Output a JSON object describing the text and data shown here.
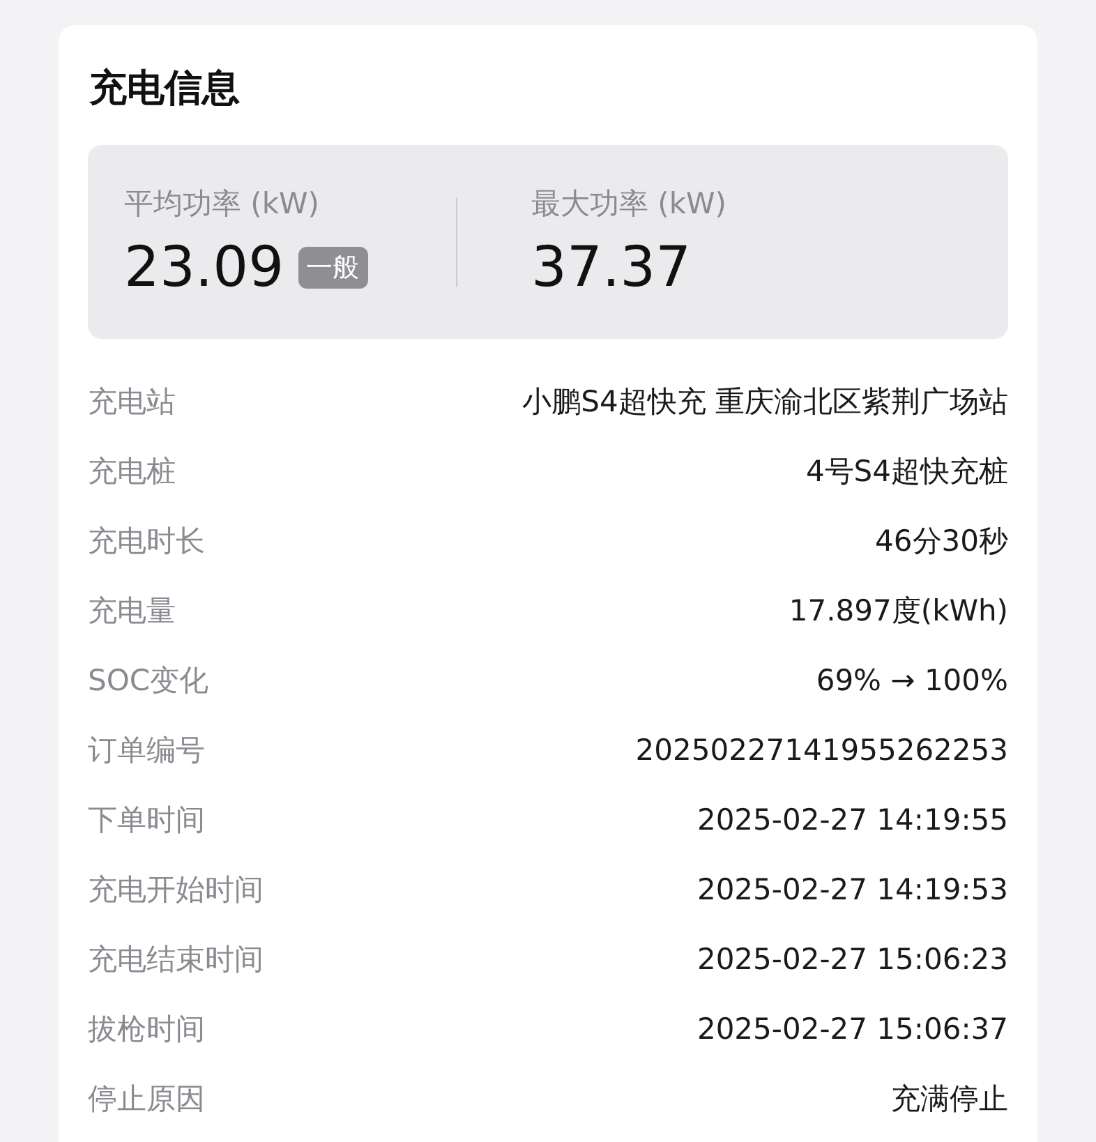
{
  "card": {
    "title": "充电信息",
    "summary": [
      {
        "label": "平均功率 (kW)",
        "value": "23.09",
        "badge": "一般"
      },
      {
        "label": "最大功率 (kW)",
        "value": "37.37"
      }
    ],
    "rows": [
      {
        "label": "充电站",
        "value": "小鹏S4超快充 重庆渝北区紫荆广场站"
      },
      {
        "label": "充电桩",
        "value": "4号S4超快充桩"
      },
      {
        "label": "充电时长",
        "value": "46分30秒"
      },
      {
        "label": "充电量",
        "value": "17.897度(kWh)"
      },
      {
        "label": "SOC变化",
        "value": "69% → 100%"
      },
      {
        "label": "订单编号",
        "value": "20250227141955262253"
      },
      {
        "label": "下单时间",
        "value": "2025-02-27 14:19:55"
      },
      {
        "label": "充电开始时间",
        "value": "2025-02-27 14:19:53"
      },
      {
        "label": "充电结束时间",
        "value": "2025-02-27 15:06:23"
      },
      {
        "label": "拔枪时间",
        "value": "2025-02-27 15:06:37"
      },
      {
        "label": "停止原因",
        "value": "充满停止"
      }
    ]
  }
}
